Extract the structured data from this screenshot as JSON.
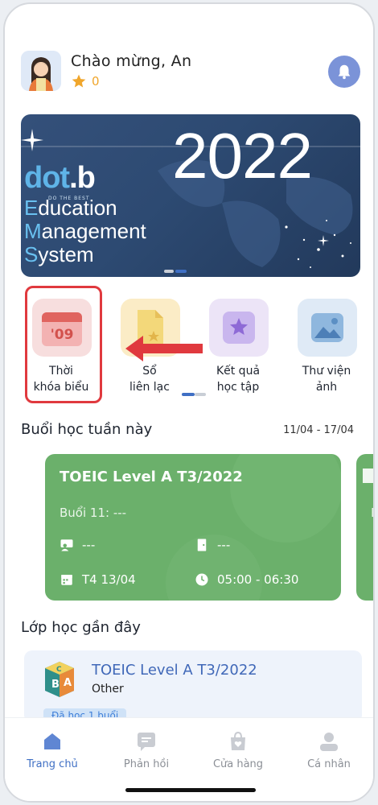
{
  "header": {
    "greeting": "Chào mừng, An",
    "points": "0"
  },
  "banner": {
    "year": "2022",
    "logo_part1": "dot",
    "logo_part2": ".b",
    "tagline": "DO THE BEST",
    "line1_cap": "E",
    "line1_rest": "ducation",
    "line2_cap": "M",
    "line2_rest": "anagement",
    "line3_cap": "S",
    "line3_rest": "ystem"
  },
  "quick_menu": [
    {
      "label": "Thời\nkhóa biểu",
      "icon": "calendar-icon",
      "icon_text": "'09",
      "color": "#f7dede"
    },
    {
      "label": "Sổ\nliên lạc",
      "icon": "document-icon",
      "color": "#fbecc6"
    },
    {
      "label": "Kết quả\nhọc tập",
      "icon": "star-icon",
      "color": "#ece4f7"
    },
    {
      "label": "Thư viện\nảnh",
      "icon": "image-icon",
      "color": "#dfeaf6"
    }
  ],
  "week": {
    "title": "Buổi học tuần này",
    "range": "11/04 - 17/04",
    "card": {
      "course": "TOEIC Level A T3/2022",
      "session": "Buổi 11: ---",
      "teacher": "---",
      "room": "---",
      "date": "T4 13/04",
      "time": "05:00 - 06:30"
    },
    "next_card_letter": "E"
  },
  "recent": {
    "title": "Lớp học gần đây",
    "course": "TOEIC Level A T3/2022",
    "type": "Other",
    "badge": "Đã học 1 buổi"
  },
  "tabs": [
    {
      "label": "Trang chủ",
      "icon": "home-icon",
      "active": true
    },
    {
      "label": "Phản hồi",
      "icon": "feedback-icon"
    },
    {
      "label": "Cửa hàng",
      "icon": "shop-icon"
    },
    {
      "label": "Cá nhân",
      "icon": "profile-icon"
    }
  ],
  "colors": {
    "accent": "#3f6fc4",
    "card_green": "#6bb06b",
    "highlight_red": "#e0393e",
    "points": "#f0a62c"
  }
}
